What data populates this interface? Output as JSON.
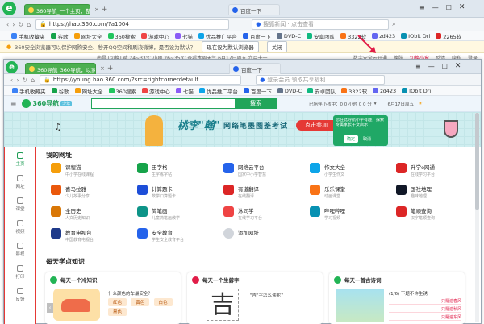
{
  "outer": {
    "tab1": "360导航_一个主页，整个世界",
    "tab2": "百度一下",
    "addr": "https://hao.360.com/?a1004",
    "search_ph": "搜狐新闻 · 点击查看",
    "bookmarks": [
      "手机收藏夹",
      "谷歌",
      "网址大全",
      "360搜索",
      "游戏中心",
      "七猫",
      "优品推广平台",
      "百度一下",
      "DVD-C",
      "安卓团队",
      "3322软",
      "zd423",
      "IObit Dri",
      "2265软"
    ],
    "notif_text": "360安全浏览器可以保护网购安全、秒开QQ空间和刷浪微博，是否设为默认？",
    "notif_btn1": "现在设为默认浏览器",
    "notif_btn2": "关闭",
    "weather": "南昌 [切换]   晴 24~33℃   小雨 26~35℃   查看本周天气   6月17日周五   六月十一",
    "right_links": [
      "数字安全云开通",
      "换肤",
      "切换小窗",
      "反馈",
      "隐私",
      "登录"
    ]
  },
  "inner": {
    "tab1": "360导航_360导航，以家长原...",
    "tab2": "百度一下",
    "addr": "https://young.hao.360.com/?src=rightcornerdefault",
    "search_ph": "登录会员 领取共享福利",
    "bookmarks": [
      "手机收藏夹",
      "谷歌",
      "网址大全",
      "360搜索",
      "游戏中心",
      "七猫",
      "优品推广平台",
      "百度一下",
      "DVD-C",
      "安卓团队",
      "3322软",
      "zd423",
      "IObit Dri"
    ],
    "logo": "360导航",
    "search_btn": "搜索",
    "timer": "已陪伴小孩中：0 0 小时 0 0 分",
    "date": "6月17日周五",
    "banner_title": "桃李\"翰\"",
    "banner_sub": "网络笔墨图鉴考试",
    "banner_btn": "点击参加",
    "tooltip_text": "您在此导航小学有趣，探索专属家长子女启示",
    "tooltip_btn1": "确定",
    "tooltip_btn2": "取消",
    "sidebar": [
      "主页",
      "网址",
      "课堂",
      "视频",
      "影视",
      "打印",
      "反馈"
    ],
    "my_sites_title": "我的网址",
    "sites": [
      {
        "name": "课程猫",
        "desc": "中小学在线课程",
        "color": "#f59e0b"
      },
      {
        "name": "田字格",
        "desc": "生字练字帖",
        "color": "#16a34a"
      },
      {
        "name": "网络云平台",
        "desc": "国家中小学智慧",
        "color": "#2563eb"
      },
      {
        "name": "作文大全",
        "desc": "小学生作文",
        "color": "#0ea5e9"
      },
      {
        "name": "升学e网通",
        "desc": "在线学习平台",
        "color": "#dc2626"
      },
      {
        "name": "喜马拉雅",
        "desc": "少儿故事分享",
        "color": "#ea580c"
      },
      {
        "name": "计算题卡",
        "desc": "数学口算题卡",
        "color": "#1d4ed8"
      },
      {
        "name": "有道翻译",
        "desc": "在线翻译",
        "color": "#dc2626"
      },
      {
        "name": "乐乐课堂",
        "desc": "动画课堂",
        "color": "#f97316"
      },
      {
        "name": "国社地理",
        "desc": "趣味地理",
        "color": "#111827"
      },
      {
        "name": "全历史",
        "desc": "人文历史知识",
        "color": "#d97706"
      },
      {
        "name": "简笔画",
        "desc": "儿童简笔画教学",
        "color": "#0d9488"
      },
      {
        "name": "沐同学",
        "desc": "在线学习平台",
        "color": "#ef4444"
      },
      {
        "name": "哔哩哔哩",
        "desc": "学习视频",
        "color": "#0891b2"
      },
      {
        "name": "笔顺查询",
        "desc": "汉字笔顺查询",
        "color": "#dc2626"
      },
      {
        "name": "教育电视台",
        "desc": "中国教育电视台",
        "color": "#1e3a8a"
      },
      {
        "name": "安全教育",
        "desc": "学生安全教育平台",
        "color": "#2563eb"
      },
      {
        "name": "添加网址",
        "desc": "",
        "color": "#d1d5db"
      }
    ],
    "daily_title": "每天学点知识",
    "cards": [
      {
        "title": "每天一个冷知识",
        "q": "什么颜色的车最安全？",
        "opts": [
          "红色",
          "黄色",
          "白色",
          "黑色"
        ]
      },
      {
        "title": "每天一个生僻字",
        "q": "\"吉\"字怎么读呢？",
        "big": "吉"
      },
      {
        "title": "每天一首古诗词",
        "text": "(1/6) 下题不许生锈",
        "opts": [
          "只羅遍春风",
          "只羅遍秋风",
          "只羅遍东风"
        ]
      }
    ]
  }
}
